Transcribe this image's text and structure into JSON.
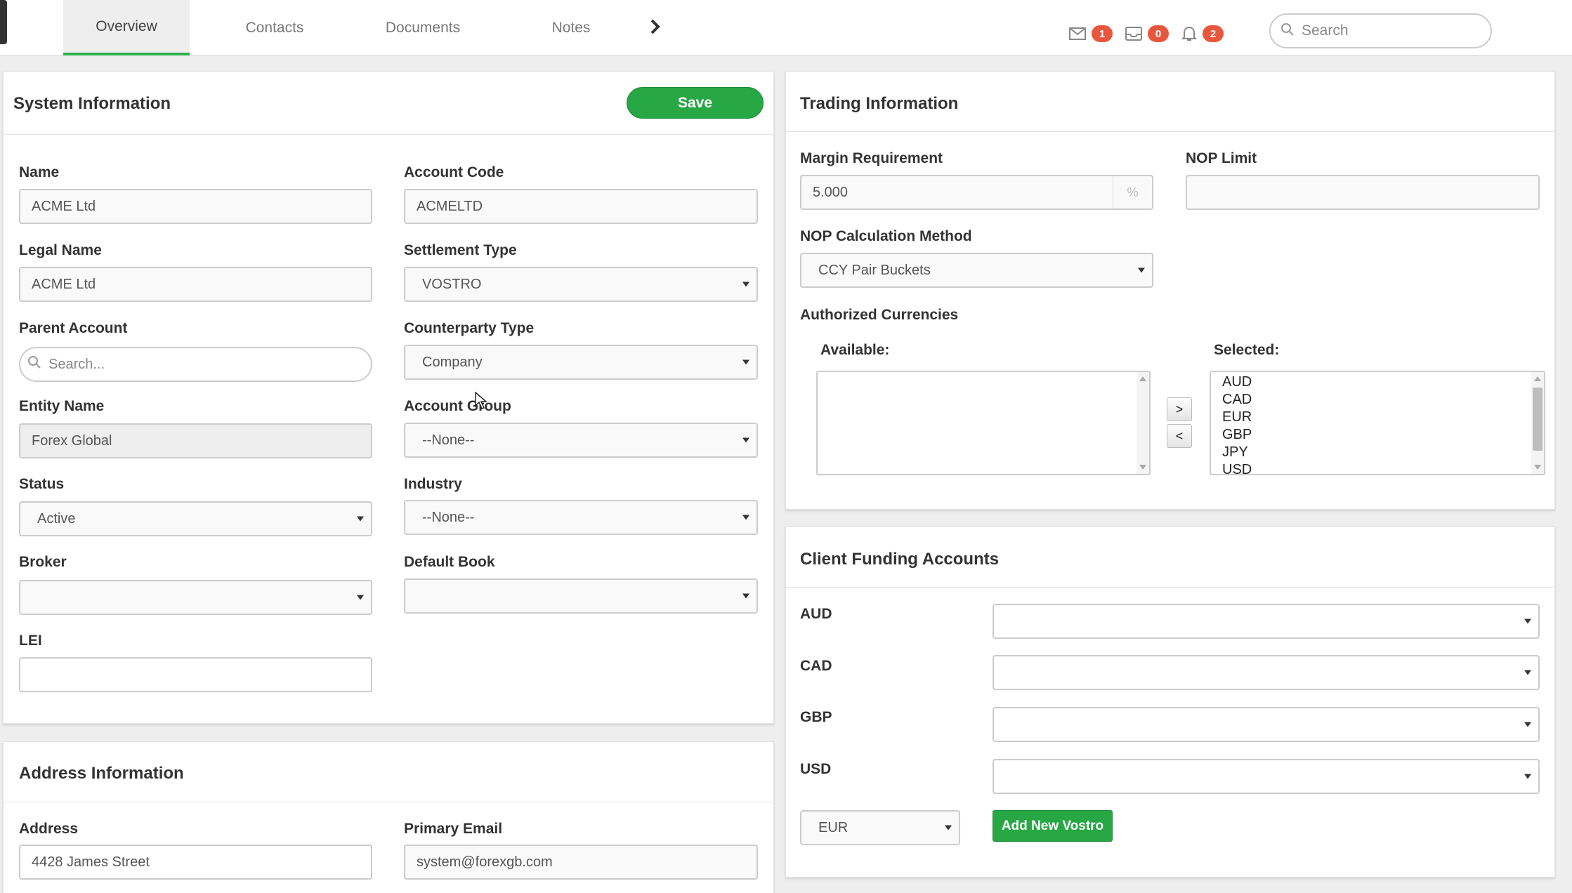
{
  "nav": {
    "tabs": [
      {
        "label": "Overview",
        "active": true
      },
      {
        "label": "Contacts"
      },
      {
        "label": "Documents"
      },
      {
        "label": "Notes"
      }
    ],
    "more_icon": "chevron-right-icon",
    "notifications": [
      {
        "icon": "mail-icon",
        "count": "1"
      },
      {
        "icon": "inbox-icon",
        "count": "0"
      },
      {
        "icon": "bell-icon",
        "count": "2"
      }
    ],
    "search_placeholder": "Search",
    "badge_color": "#e8573d",
    "active_tab_color": "#2bb24c"
  },
  "system_info": {
    "title": "System Information",
    "save_label": "Save",
    "name_label": "Name",
    "name_value": "ACME Ltd",
    "account_code_label": "Account Code",
    "account_code_value": "ACMELTD",
    "legal_name_label": "Legal Name",
    "legal_name_value": "ACME Ltd",
    "settlement_type_label": "Settlement Type",
    "settlement_type_value": "VOSTRO",
    "parent_account_label": "Parent Account",
    "parent_account_placeholder": "Search...",
    "counterparty_type_label": "Counterparty Type",
    "counterparty_type_value": "Company",
    "entity_name_label": "Entity Name",
    "entity_name_value": "Forex Global",
    "account_group_label": "Account Group",
    "account_group_value": "--None--",
    "status_label": "Status",
    "status_value": "Active",
    "industry_label": "Industry",
    "industry_value": "--None--",
    "broker_label": "Broker",
    "broker_value": "",
    "default_book_label": "Default Book",
    "default_book_value": "",
    "lei_label": "LEI",
    "lei_value": ""
  },
  "address_info": {
    "title": "Address Information",
    "address_label": "Address",
    "address_value": "4428 James Street",
    "primary_email_label": "Primary Email",
    "primary_email_value": "system@forexgb.com"
  },
  "trading_info": {
    "title": "Trading Information",
    "margin_label": "Margin Requirement",
    "margin_value": "5.000",
    "margin_unit": "%",
    "nop_limit_label": "NOP Limit",
    "nop_limit_value": "",
    "nop_method_label": "NOP Calculation Method",
    "nop_method_value": "CCY Pair Buckets",
    "auth_currencies_label": "Authorized Currencies",
    "available_label": "Available:",
    "selected_label": "Selected:",
    "available": [],
    "selected": [
      "AUD",
      "CAD",
      "EUR",
      "GBP",
      "JPY",
      "USD"
    ],
    "move_right_label": ">",
    "move_left_label": "<"
  },
  "funding": {
    "title": "Client Funding Accounts",
    "rows": [
      {
        "currency": "AUD",
        "value": ""
      },
      {
        "currency": "CAD",
        "value": ""
      },
      {
        "currency": "GBP",
        "value": ""
      },
      {
        "currency": "USD",
        "value": ""
      }
    ],
    "new_currency_value": "EUR",
    "add_button_label": "Add New Vostro"
  },
  "colors": {
    "save_button": "#28a745",
    "add_button": "#28a745"
  }
}
